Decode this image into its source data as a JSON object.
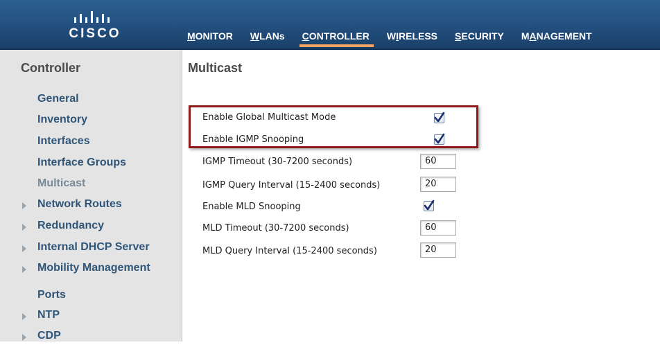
{
  "brand": {
    "logo_text": "CISCO"
  },
  "nav": {
    "items": [
      {
        "pre": "",
        "u": "M",
        "post": "ONITOR"
      },
      {
        "pre": "",
        "u": "W",
        "post": "LANs"
      },
      {
        "pre": "",
        "u": "C",
        "post": "ONTROLLER"
      },
      {
        "pre": "W",
        "u": "I",
        "post": "RELESS"
      },
      {
        "pre": "",
        "u": "S",
        "post": "ECURITY"
      },
      {
        "pre": "M",
        "u": "A",
        "post": "NAGEMENT"
      }
    ],
    "active": "CONTROLLER"
  },
  "sidebar": {
    "title": "Controller",
    "items": [
      {
        "label": "General",
        "expandable": false
      },
      {
        "label": "Inventory",
        "expandable": false
      },
      {
        "label": "Interfaces",
        "expandable": false
      },
      {
        "label": "Interface Groups",
        "expandable": false
      },
      {
        "label": "Multicast",
        "expandable": false,
        "current": true
      },
      {
        "label": "Network Routes",
        "expandable": true
      },
      {
        "label": "Redundancy",
        "expandable": true
      },
      {
        "label": "Internal DHCP Server",
        "expandable": true
      },
      {
        "label": "Mobility Management",
        "expandable": true
      },
      {
        "label": "Ports",
        "expandable": false
      },
      {
        "label": "NTP",
        "expandable": true
      },
      {
        "label": "CDP",
        "expandable": true
      }
    ]
  },
  "main": {
    "title": "Multicast",
    "fields": [
      {
        "label": "Enable Global Multicast Mode",
        "type": "checkbox",
        "checked": true
      },
      {
        "label": "Enable IGMP Snooping",
        "type": "checkbox",
        "checked": true
      },
      {
        "label": "IGMP Timeout (30-7200 seconds)",
        "type": "number",
        "value": "60"
      },
      {
        "label": "IGMP Query Interval (15-2400 seconds)",
        "type": "number",
        "value": "20"
      },
      {
        "label": "Enable MLD Snooping",
        "type": "checkbox",
        "checked": true
      },
      {
        "label": "MLD Timeout (30-7200 seconds)",
        "type": "number",
        "value": "60"
      },
      {
        "label": "MLD Query Interval (15-2400 seconds)",
        "type": "number",
        "value": "20"
      }
    ]
  },
  "colors": {
    "header_bg": "#234f7e",
    "nav_active_underline": "#f4a261",
    "sidebar_bg": "#e4e4e4",
    "sidebar_link": "#2f5679",
    "highlight_border": "#8b1a1a"
  }
}
